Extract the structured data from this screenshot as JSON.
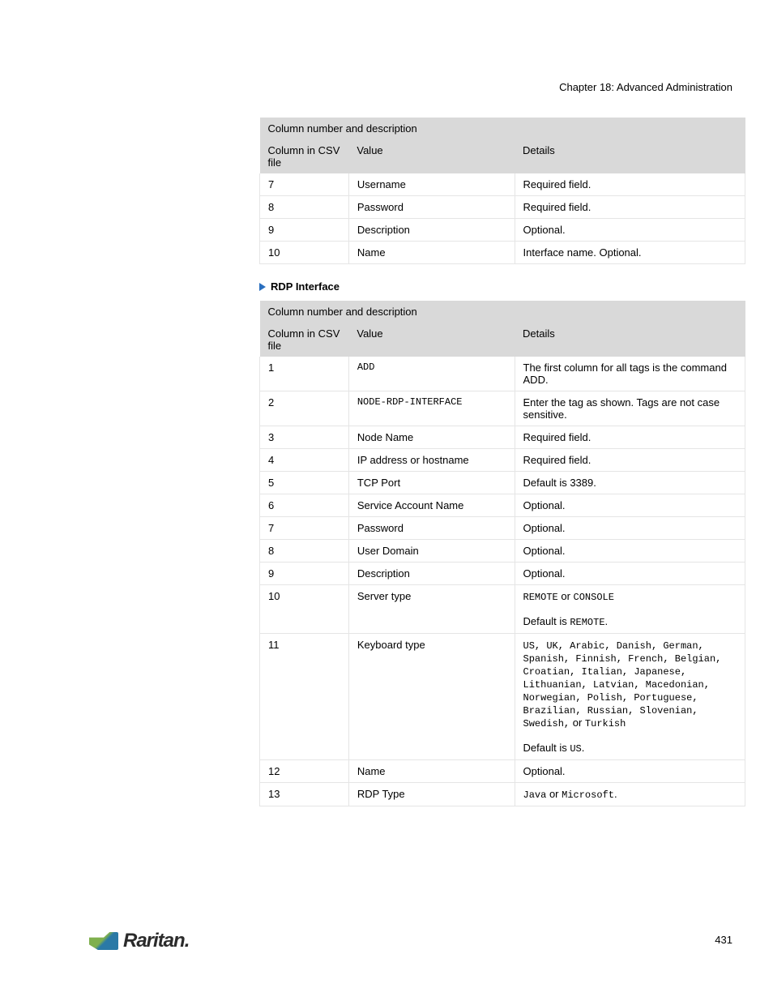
{
  "header": {
    "chapter": "Chapter 18: Advanced Administration"
  },
  "table1": {
    "header": "Column number and description",
    "col1": "Column in CSV file",
    "col2": "Value",
    "col3": "Details",
    "rows": [
      {
        "c1": "7",
        "c2": "Username",
        "c3": "Required field."
      },
      {
        "c1": "8",
        "c2": "Password",
        "c3": "Required field."
      },
      {
        "c1": "9",
        "c2": "Description",
        "c3": "Optional."
      },
      {
        "c1": "10",
        "c2": "Name",
        "c3": "Interface name. Optional."
      }
    ]
  },
  "section": {
    "title": "RDP Interface"
  },
  "table2": {
    "header": "Column number and description",
    "col1": "Column in CSV file",
    "col2": "Value",
    "col3": "Details",
    "rows": [
      {
        "c1": "1",
        "c2": "ADD",
        "c2mono": true,
        "c3": "The first column for all tags is the command ADD.",
        "c3mono": false
      },
      {
        "c1": "2",
        "c2": "NODE-RDP-INTERFACE",
        "c2mono": true,
        "c3": "Enter the tag as shown. Tags are not case sensitive.",
        "c3mono": false
      },
      {
        "c1": "3",
        "c2": "Node Name",
        "c3": "Required field."
      },
      {
        "c1": "4",
        "c2": "IP address or hostname",
        "c3": "Required field."
      },
      {
        "c1": "5",
        "c2": "TCP Port",
        "c3": "Default is 3389."
      },
      {
        "c1": "6",
        "c2": "Service Account Name",
        "c3": "Optional."
      },
      {
        "c1": "7",
        "c2": "Password",
        "c3": "Optional."
      },
      {
        "c1": "8",
        "c2": "User Domain",
        "c3": "Optional."
      },
      {
        "c1": "9",
        "c2": "Description",
        "c3": "Optional."
      },
      {
        "c1": "10",
        "c2": "Server type",
        "c3html": "<span class=\"mono\">REMOTE</span> or <span class=\"mono\">CONSOLE</span><br><br>Default is <span class=\"mono\">REMOTE</span>."
      },
      {
        "c1": "11",
        "c2": "Keyboard type",
        "c3html": "<span class=\"mono\">US, UK, Arabic, Danish, German, Spanish, Finnish, French, Belgian, Croatian, Italian, Japanese, Lithuanian, Latvian, Macedonian, Norwegian, Polish, Portuguese, Brazilian, Russian, Slovenian,</span> <span class=\"mono\">Swedish,</span> or <span class=\"mono\">Turkish</span><br><br>Default is <span class=\"mono\">US</span>."
      },
      {
        "c1": "12",
        "c2": "Name",
        "c3": "Optional."
      },
      {
        "c1": "13",
        "c2": "RDP Type",
        "c3html": "<span class=\"mono\">Java</span> or <span class=\"mono\">Microsoft</span>."
      }
    ]
  },
  "footer": {
    "brand": "Raritan.",
    "page_number": "431"
  }
}
